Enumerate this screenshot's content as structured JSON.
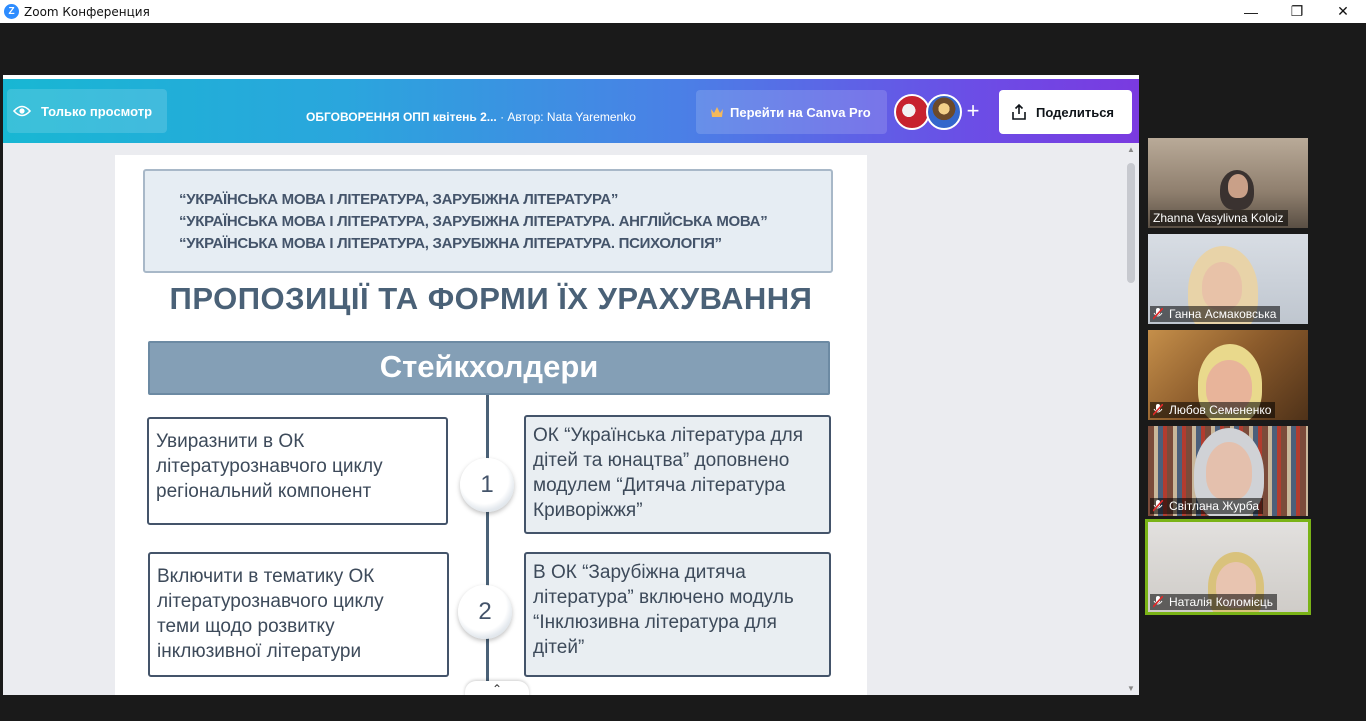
{
  "window": {
    "title": "Zoom Конференция",
    "logo_letter": "Z",
    "controls": [
      "—",
      "❐",
      "✕"
    ]
  },
  "canva": {
    "view_only": "Только просмотр",
    "doc_title": "ОБГОВОРЕННЯ ОПП квітень 2...",
    "doc_author": " · Автор: Nata Yaremenko",
    "canva_pro": "Перейти на Canva Pro",
    "plus": "+",
    "share": "Поделиться"
  },
  "slide": {
    "programs": [
      "“УКРАЇНСЬКА МОВА І ЛІТЕРАТУРА, ЗАРУБІЖНА ЛІТЕРАТУРА”",
      "“УКРАЇНСЬКА МОВА І ЛІТЕРАТУРА, ЗАРУБІЖНА ЛІТЕРАТУРА. АНГЛІЙСЬКА МОВА”",
      "“УКРАЇНСЬКА МОВА І ЛІТЕРАТУРА, ЗАРУБІЖНА ЛІТЕРАТУРА. ПСИХОЛОГІЯ”"
    ],
    "heading": "ПРОПОЗИЦІЇ ТА ФОРМИ ЇХ УРАХУВАННЯ",
    "stakeholders": "Стейкхолдери",
    "rows": [
      {
        "number": "1",
        "proposal": [
          "Увиразнити в ОК",
          "літературознавчого циклу",
          "регіональний компонент"
        ],
        "response": [
          "ОК “Українська література для",
          "дітей та юнацтва” доповнено",
          "модулем “Дитяча література",
          "Криворіжжя”"
        ]
      },
      {
        "number": "2",
        "proposal": [
          "Включити в тематику ОК",
          "літературознавчого циклу",
          "теми щодо розвитку",
          "інклюзивної літератури"
        ],
        "response": [
          "В ОК “Зарубіжна дитяча",
          "література” включено модуль",
          "“Інклюзивна література для",
          "дітей”"
        ]
      }
    ]
  },
  "participants": [
    {
      "name": "Zhanna Vasylivna Koloiz",
      "muted": false,
      "active": false
    },
    {
      "name": "Ганна Асмаковська",
      "muted": true,
      "active": false
    },
    {
      "name": "Любов Семененко",
      "muted": true,
      "active": false
    },
    {
      "name": "Світлана Журба",
      "muted": true,
      "active": false
    },
    {
      "name": "Наталія Коломієць",
      "muted": true,
      "active": true
    }
  ],
  "colors": {
    "canva_gradient_start": "#18b7d3",
    "canva_gradient_end": "#7a3ae0",
    "slide_text": "#44546a",
    "stakeholder_bar": "#849fb6",
    "active_speaker_border": "#7ab317"
  }
}
